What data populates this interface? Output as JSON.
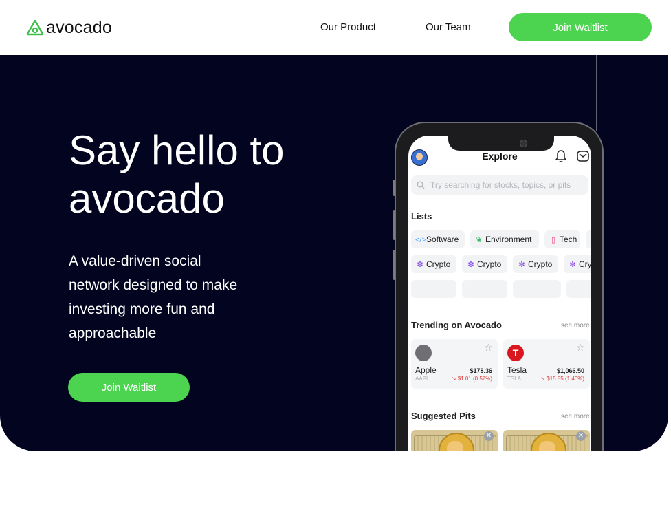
{
  "header": {
    "logo_text": "avocado",
    "nav": {
      "product": "Our Product",
      "team": "Our Team"
    },
    "cta": "Join Waitlist"
  },
  "hero": {
    "title": "Say hello to avocado",
    "subtitle": "A value-driven social network designed to make investing more fun and approachable",
    "cta": "Join Waitlist"
  },
  "app": {
    "screen_title": "Explore",
    "search_placeholder": "Try searching for stocks, topics, or pits",
    "lists_title": "Lists",
    "list_chips": [
      {
        "label": "Software",
        "icon": "code-icon"
      },
      {
        "label": "Environment",
        "icon": "leaf-icon"
      },
      {
        "label": "Tech",
        "icon": "phone-icon"
      },
      {
        "label": "Crypto",
        "icon": "crypto-icon"
      },
      {
        "label": "Crypto",
        "icon": "crypto-icon"
      },
      {
        "label": "Crypto",
        "icon": "crypto-icon"
      },
      {
        "label": "Cry",
        "icon": "crypto-icon"
      }
    ],
    "trending_title": "Trending on Avocado",
    "see_more": "see more",
    "trending": [
      {
        "name": "Apple",
        "ticker": "AAPL",
        "price": "$178.36",
        "change": "↘ $1.01 (0.57%)"
      },
      {
        "name": "Tesla",
        "ticker": "TSLA",
        "price": "$1,066.50",
        "change": "↘ $15.85 (1.46%)"
      }
    ],
    "suggested_title": "Suggested Pits",
    "colors": {
      "brand_green": "#4cd450",
      "hero_bg": "#020420",
      "loss_red": "#e23a3a"
    }
  }
}
